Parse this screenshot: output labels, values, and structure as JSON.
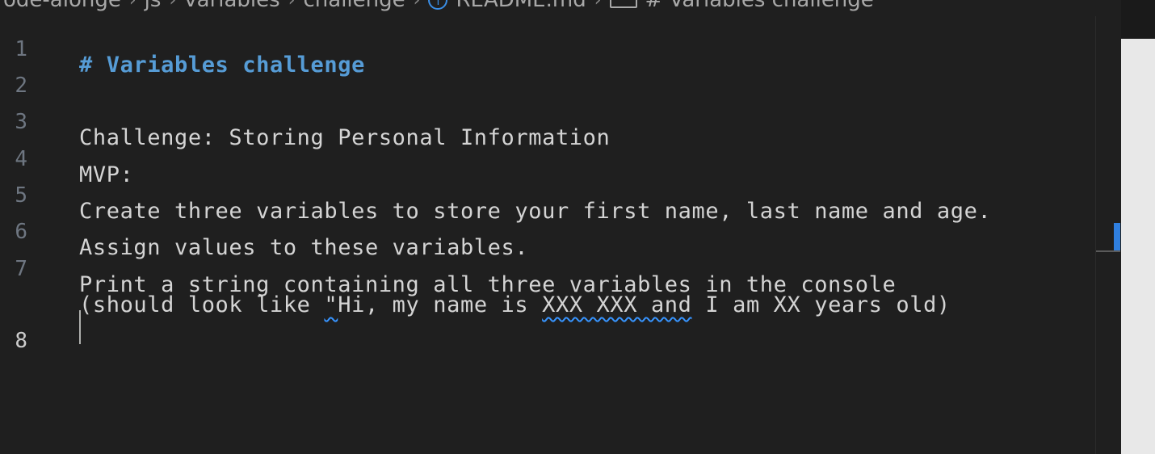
{
  "breadcrumb": {
    "items": [
      "ode-alonge",
      "js",
      "variables",
      "challenge",
      "README.md",
      "# Variables challenge"
    ],
    "separator": "›"
  },
  "editor": {
    "lines": [
      {
        "number": "1",
        "text": "# Variables challenge"
      },
      {
        "number": "2",
        "text": ""
      },
      {
        "number": "3",
        "text": "Challenge: Storing Personal Information"
      },
      {
        "number": "4",
        "text": "MVP:"
      },
      {
        "number": "5",
        "text": "Create three variables to store your first name, last name and age."
      },
      {
        "number": "6",
        "text": "Assign values to these variables."
      },
      {
        "number": "7",
        "text": "Print a string containing all three variables in the console"
      },
      {
        "number": "",
        "text_parts": [
          "(should look like ",
          "\"",
          "Hi, my name is ",
          "XXX XXX and",
          " I am XX years old)"
        ]
      },
      {
        "number": "8",
        "text": ""
      }
    ]
  },
  "colors": {
    "heading": "#569cd6",
    "squiggle": "#3794ff",
    "accent": "#2f7fe0"
  }
}
